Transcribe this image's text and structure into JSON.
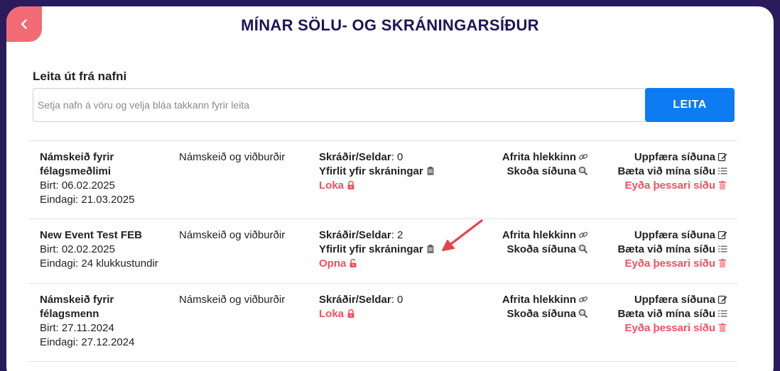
{
  "header": {
    "title": "MÍNAR SÖLU- OG SKRÁNINGARSÍÐUR"
  },
  "search": {
    "label": "Leita út frá nafni",
    "placeholder": "Setja nafn á vöru og velja bláa takkann fyrir leita",
    "button_label": "LEITA"
  },
  "labels": {
    "registered_key": "Skráðir/Seldar",
    "overview": "Yfirlit yfir skráningar",
    "copy_link": "Afrita hlekkinn",
    "view_page": "Skoða síðuna",
    "update_page": "Uppfæra síðuna",
    "add_to_my_pages": "Bæta við mína síðu",
    "delete_page": "Eyða þessari síðu"
  },
  "rows": [
    {
      "name": "Námskeið fyrir félagsmeðlimi",
      "published": "Birt: 06.02.2025",
      "deadline": "Eindagi: 21.03.2025",
      "category": "Námskeið og viðburðir",
      "registered_value": ": 0",
      "status": "Loka"
    },
    {
      "name": "New Event Test FEB",
      "published": "Birt: 02.02.2025",
      "deadline": "Eindagi: 24 klukkustundir",
      "category": "Námskeið og viðburðir",
      "registered_value": ": 2",
      "status": "Opna"
    },
    {
      "name": "Námskeið fyrir félagsmenn",
      "published": "Birt: 27.11.2024",
      "deadline": "Eindagi: 27.12.2024",
      "category": "Námskeið og viðburðir",
      "registered_value": ": 0",
      "status": "Loka"
    }
  ],
  "colors": {
    "background": "#2a1b5c",
    "accent_red": "#f0525e",
    "back_button": "#f26b74",
    "primary_blue": "#0d7cf2",
    "title": "#1e1557"
  },
  "icons": [
    "chevron-left-icon",
    "clipboard-icon",
    "lock-closed-icon",
    "lock-open-icon",
    "link-icon",
    "magnifier-icon",
    "edit-icon",
    "list-icon",
    "trash-icon",
    "annotation-arrow"
  ]
}
